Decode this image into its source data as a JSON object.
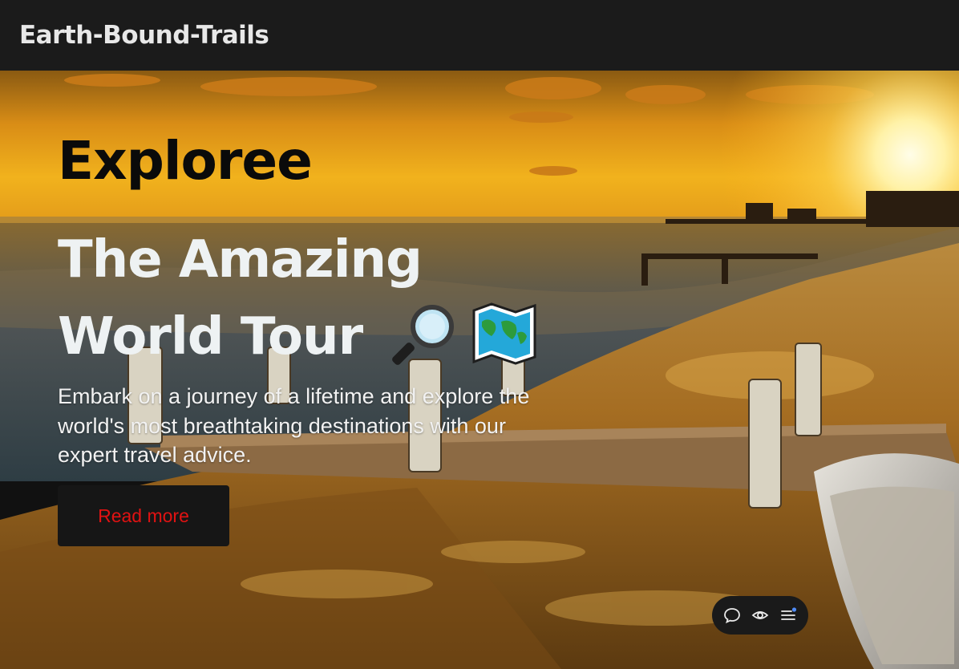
{
  "brand": {
    "name": "Earth-Bound-Trails"
  },
  "hero": {
    "eyebrow": "Exploree",
    "headline_line1": "The Amazing",
    "headline_line2": "World Tour",
    "headline_icons": [
      "magnifying-glass-icon",
      "world-map-icon"
    ],
    "description": "Embark on a journey of a lifetime and explore the world's most breathtaking destinations with our expert travel advice.",
    "cta_label": "Read more"
  },
  "floating_toolbar": {
    "icons": [
      "chat-bubble-icon",
      "eye-icon",
      "menu-icon"
    ],
    "notification_dot_color": "#4f8cf7"
  },
  "colors": {
    "navbar_bg": "#1b1b1b",
    "cta_bg": "#161616",
    "cta_text": "#e11212",
    "headline_text": "#eef2f3"
  }
}
